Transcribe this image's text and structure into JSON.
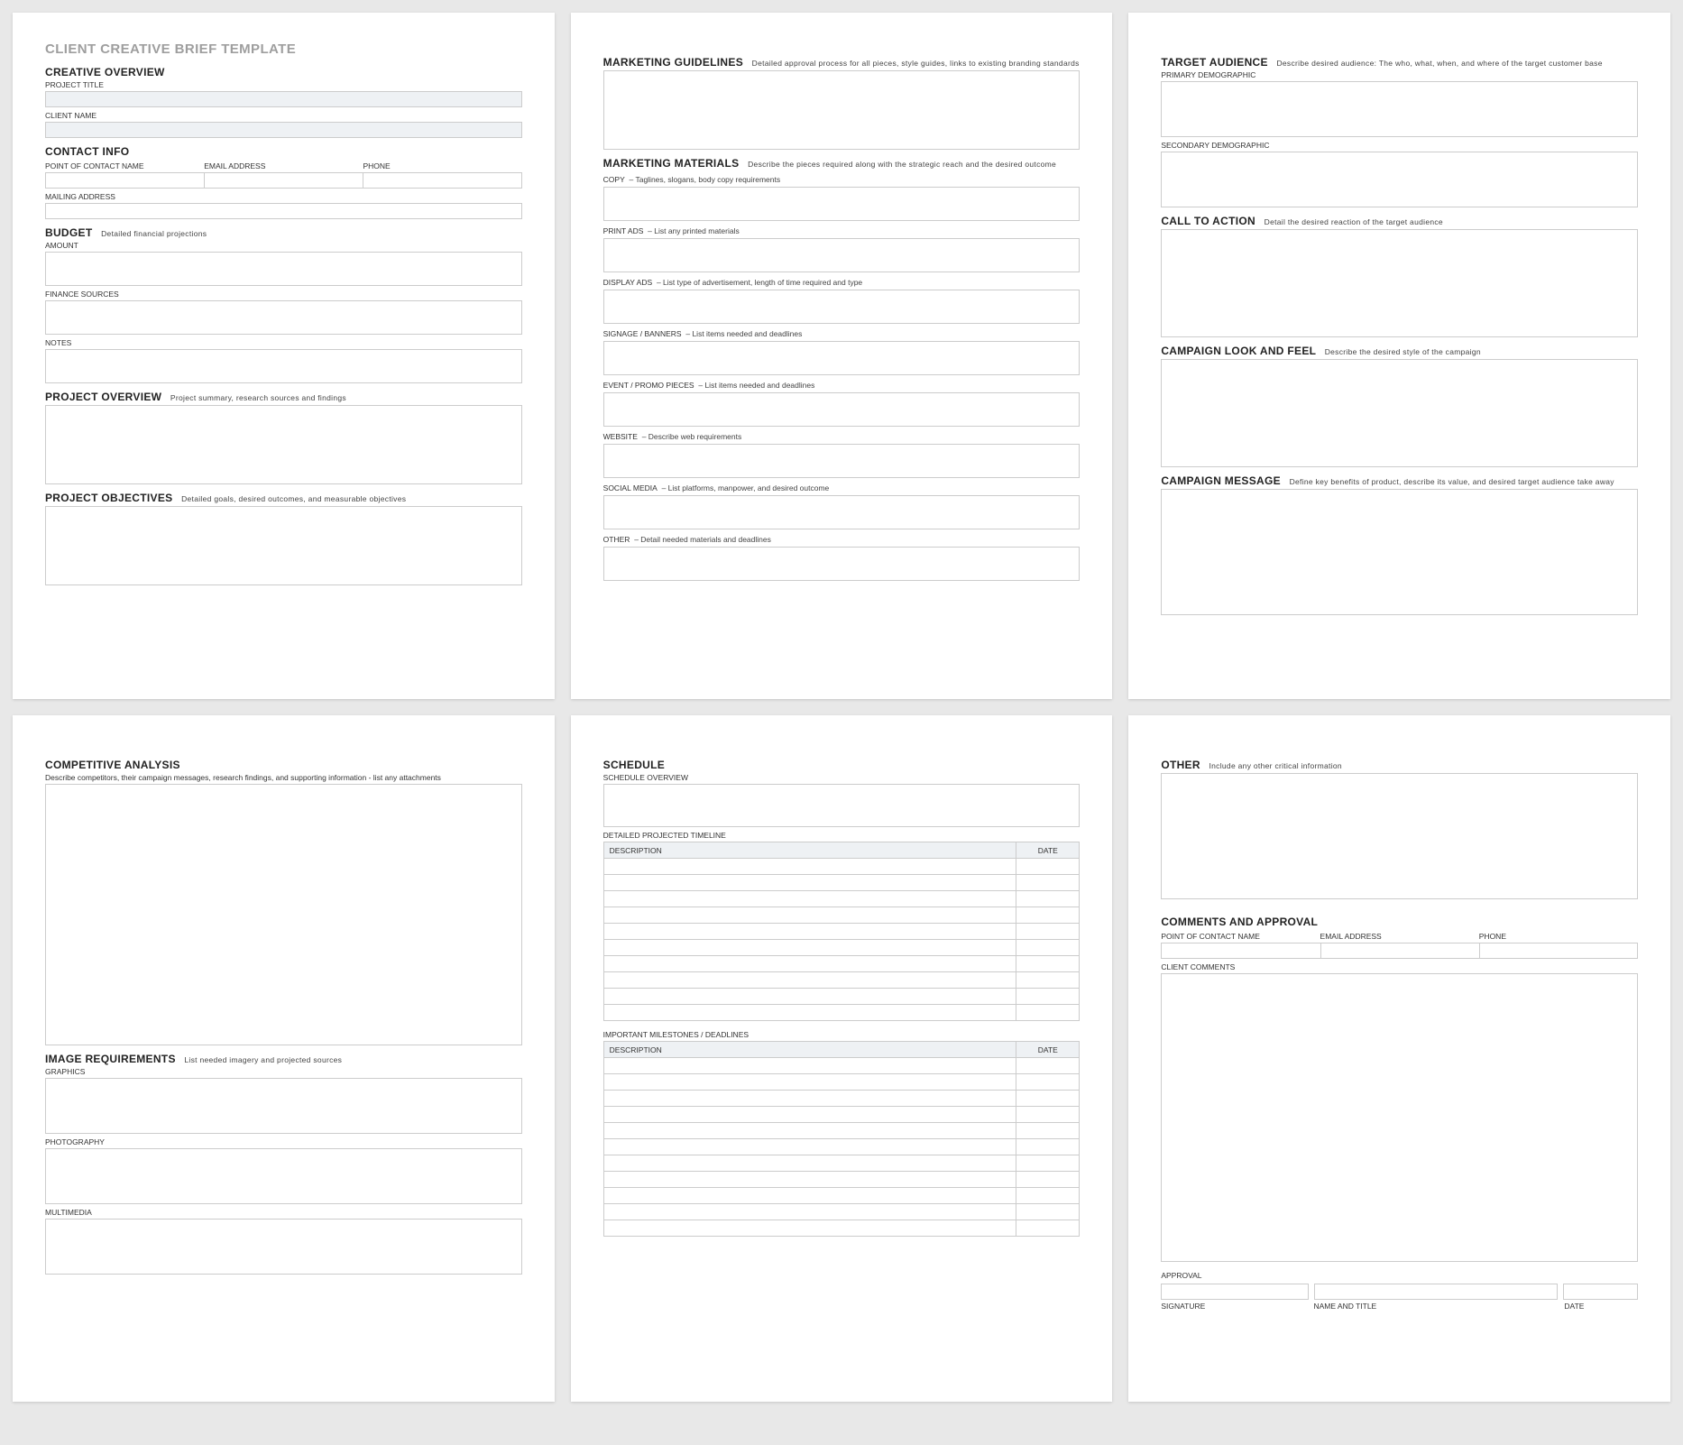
{
  "doc_title": "CLIENT CREATIVE BRIEF TEMPLATE",
  "page1": {
    "creative_overview": "CREATIVE OVERVIEW",
    "project_title": "PROJECT TITLE",
    "client_name": "CLIENT NAME",
    "contact_info": "CONTACT INFO",
    "poc_name": "POINT OF CONTACT NAME",
    "email": "EMAIL ADDRESS",
    "phone": "PHONE",
    "mailing_address": "MAILING ADDRESS",
    "budget": "BUDGET",
    "budget_desc": "Detailed financial projections",
    "amount": "AMOUNT",
    "finance_sources": "FINANCE SOURCES",
    "notes": "NOTES",
    "project_overview": "PROJECT OVERVIEW",
    "project_overview_desc": "Project summary, research sources and findings",
    "project_objectives": "PROJECT OBJECTIVES",
    "project_objectives_desc": "Detailed goals, desired outcomes, and measurable objectives"
  },
  "page2": {
    "marketing_guidelines": "MARKETING GUIDELINES",
    "marketing_guidelines_desc": "Detailed approval process for all pieces, style guides, links to existing branding standards",
    "marketing_materials": "MARKETING MATERIALS",
    "marketing_materials_desc": "Describe the pieces required along with the strategic reach and the desired outcome",
    "copy": "COPY",
    "copy_desc": "– Taglines, slogans, body copy requirements",
    "print_ads": "PRINT ADS",
    "print_ads_desc": "– List any printed materials",
    "display_ads": "DISPLAY ADS",
    "display_ads_desc": "– List type of advertisement, length of time required and type",
    "signage": "SIGNAGE / BANNERS",
    "signage_desc": "– List items needed and deadlines",
    "event": "EVENT / PROMO PIECES",
    "event_desc": "– List items needed and deadlines",
    "website": "WEBSITE",
    "website_desc": "– Describe web requirements",
    "social": "SOCIAL MEDIA",
    "social_desc": "– List platforms, manpower, and desired outcome",
    "other": "OTHER",
    "other_desc": "– Detail needed materials and deadlines"
  },
  "page3": {
    "target_audience": "TARGET AUDIENCE",
    "target_audience_desc": "Describe desired audience: The who, what, when, and where of the target customer base",
    "primary": "PRIMARY DEMOGRAPHIC",
    "secondary": "SECONDARY DEMOGRAPHIC",
    "cta": "CALL TO ACTION",
    "cta_desc": "Detail the desired reaction of the target audience",
    "look": "CAMPAIGN LOOK AND FEEL",
    "look_desc": "Describe the desired style of the campaign",
    "message": "CAMPAIGN MESSAGE",
    "message_desc": "Define key benefits of product, describe its value, and desired target audience take away"
  },
  "page4": {
    "competitive": "COMPETITIVE ANALYSIS",
    "competitive_desc": "Describe competitors, their campaign messages, research findings, and supporting information - list any attachments",
    "image_reqs": "IMAGE REQUIREMENTS",
    "image_reqs_desc": "List needed imagery and projected sources",
    "graphics": "GRAPHICS",
    "photography": "PHOTOGRAPHY",
    "multimedia": "MULTIMEDIA"
  },
  "page5": {
    "schedule": "SCHEDULE",
    "overview": "SCHEDULE OVERVIEW",
    "timeline": "DETAILED PROJECTED TIMELINE",
    "th_desc": "DESCRIPTION",
    "th_date": "DATE",
    "milestones": "IMPORTANT MILESTONES / DEADLINES"
  },
  "page6": {
    "other": "OTHER",
    "other_desc": "Include any other critical information",
    "comments_approval": "COMMENTS AND APPROVAL",
    "poc_name": "POINT OF CONTACT NAME",
    "email": "EMAIL ADDRESS",
    "phone": "PHONE",
    "client_comments": "CLIENT COMMENTS",
    "approval": "APPROVAL",
    "signature": "SIGNATURE",
    "name_title": "NAME AND TITLE",
    "date": "DATE"
  }
}
